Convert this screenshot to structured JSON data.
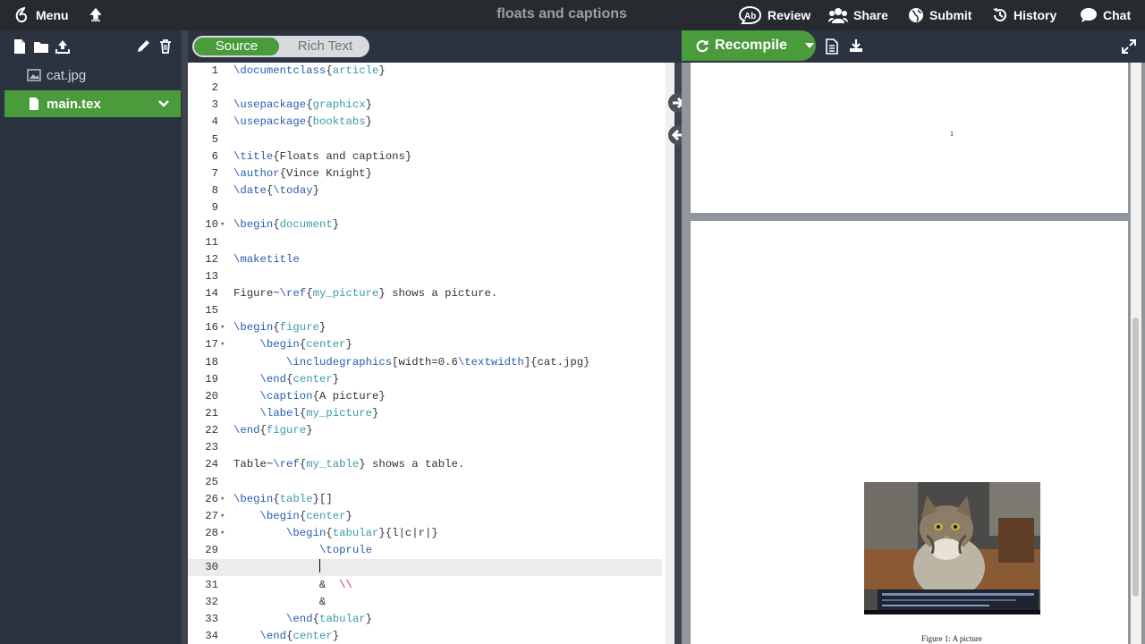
{
  "topbar": {
    "menu_label": "Menu",
    "project_title": "floats and captions",
    "review_label": "Review",
    "share_label": "Share",
    "submit_label": "Submit",
    "history_label": "History",
    "chat_label": "Chat"
  },
  "file_tree": {
    "items": [
      {
        "name": "cat.jpg",
        "type": "image"
      },
      {
        "name": "main.tex",
        "type": "tex",
        "active": true
      }
    ]
  },
  "editor": {
    "mode_source": "Source",
    "mode_rich": "Rich Text",
    "current_line": 30
  },
  "pdf": {
    "recompile_label": "Recompile",
    "page_number": "1",
    "figure_caption": "Figure 1: A picture"
  },
  "colors": {
    "accent_green": "#4a9b3c",
    "topbar_bg": "#272a2f",
    "sidebar_bg": "#2c3340"
  }
}
